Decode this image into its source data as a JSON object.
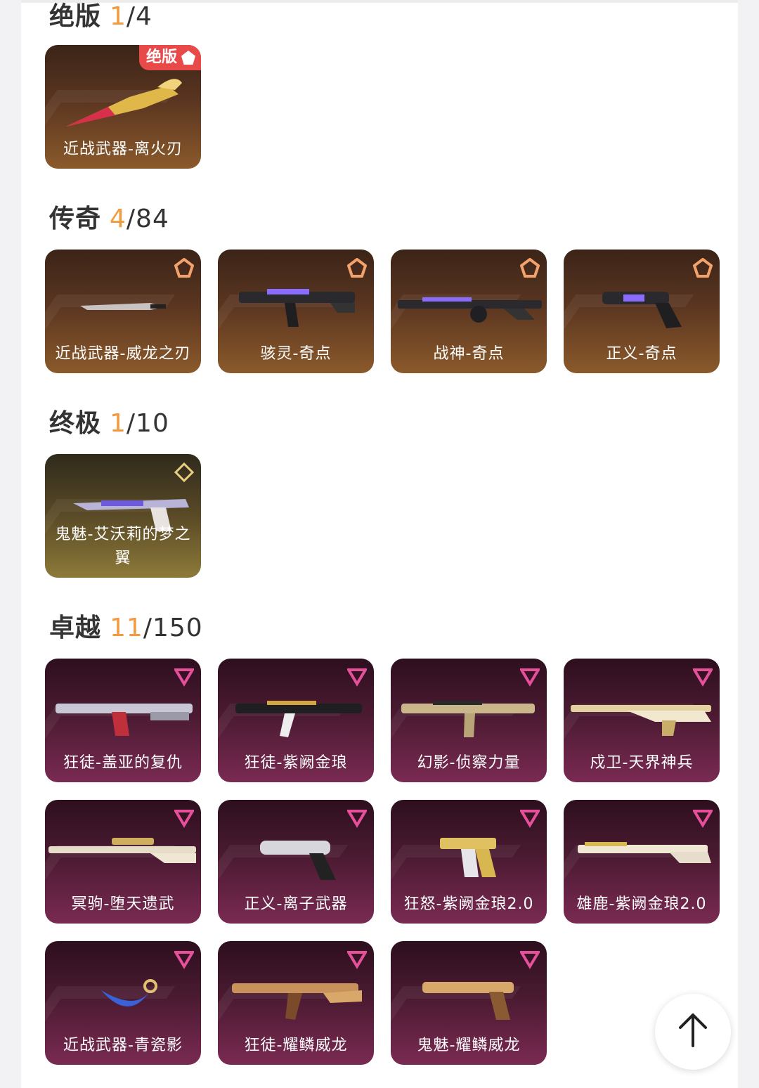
{
  "sections": {
    "limited": {
      "name": "绝版",
      "owned": "1",
      "total": "/4",
      "badge": "绝版",
      "items": [
        {
          "label": "近战武器-离火刃"
        }
      ]
    },
    "legend": {
      "name": "传奇",
      "owned": "4",
      "total": "/84",
      "items": [
        {
          "label": "近战武器-威龙之刃"
        },
        {
          "label": "骇灵-奇点"
        },
        {
          "label": "战神-奇点"
        },
        {
          "label": "正义-奇点"
        }
      ]
    },
    "ultimate": {
      "name": "终极",
      "owned": "1",
      "total": "/10",
      "items": [
        {
          "label": "鬼魅-艾沃莉的梦之翼"
        }
      ]
    },
    "premium": {
      "name": "卓越",
      "owned": "11",
      "total": "/150",
      "items": [
        {
          "label": "狂徒-盖亚的复仇"
        },
        {
          "label": "狂徒-紫阙金琅"
        },
        {
          "label": "幻影-侦察力量"
        },
        {
          "label": "戍卫-天界神兵"
        },
        {
          "label": "冥驹-堕天遗武"
        },
        {
          "label": "正义-离子武器"
        },
        {
          "label": "狂怒-紫阙金琅2.0"
        },
        {
          "label": "雄鹿-紫阙金琅2.0"
        },
        {
          "label": "近战武器-青瓷影"
        },
        {
          "label": "狂徒-耀鳞威龙"
        },
        {
          "label": "鬼魅-耀鳞威龙"
        }
      ]
    }
  },
  "colors": {
    "owned": "#f29a3d",
    "limited_badge": "#e84a4a"
  },
  "icons": {
    "scroll_top": "arrow-up-icon"
  }
}
